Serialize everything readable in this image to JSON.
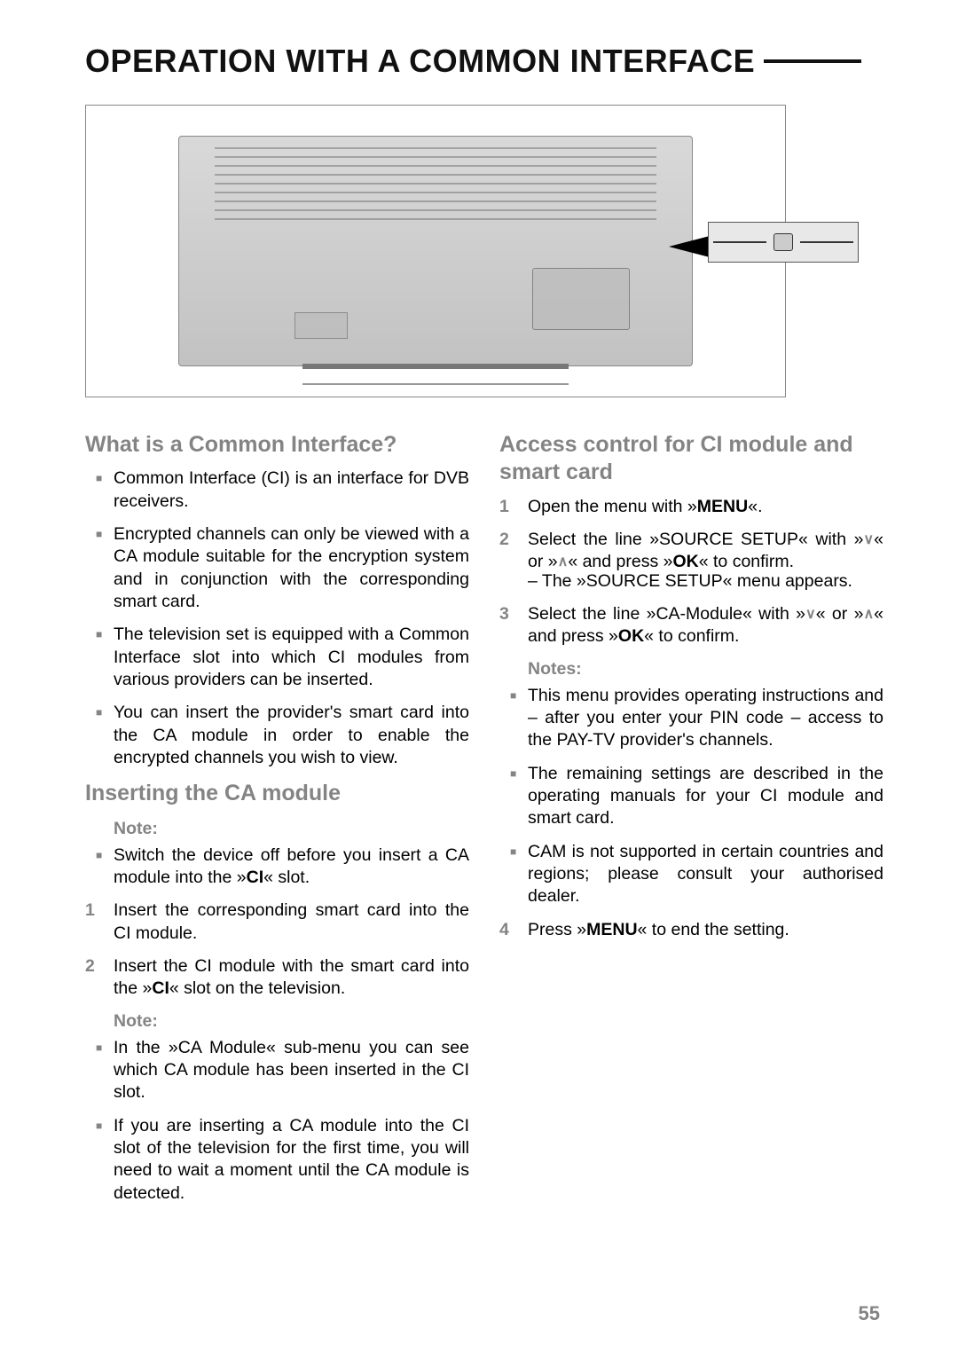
{
  "title": "OPERATION WITH A COMMON INTERFACE",
  "page_number": "55",
  "left": {
    "h_what": "What is a Common Interface?",
    "what_bullets": [
      "Common Interface (CI) is an interface for DVB receivers.",
      "Encrypted channels can only be viewed with a CA module suitable for the encryption system and in conjunction with the corresponding smart card.",
      "The television set is equipped with a Common Interface slot into which CI modules from various providers can be inserted.",
      "You can insert the provider's smart card into the CA module in order to enable the encrypted channels you wish to view."
    ],
    "h_insert": "Inserting the CA module",
    "note_label": "Note:",
    "note1": [
      "Switch the device off before you insert a CA module into the »CI« slot."
    ],
    "steps": [
      "Insert the corresponding smart card into the CI module.",
      "Insert the CI module with the smart card into the »CI« slot on the television."
    ],
    "note2": [
      "In the »CA Module« sub-menu you can see which CA module has been inserted in the CI slot.",
      "If you are inserting a CA module into the CI slot of the television for the first time, you will need to wait a moment until the CA module is detected."
    ]
  },
  "right": {
    "h_access": "Access control for CI module and smart card",
    "step1_pre": "Open the menu with »",
    "step1_bold": "MENU",
    "step1_post": "«.",
    "step2_pre": "Select the line »SOURCE SETUP« with »",
    "step2_mid": "« or »",
    "step2_mid2": "« and press »",
    "step2_bold": "OK",
    "step2_post": "« to confirm.",
    "step2_sub": "– The »SOURCE SETUP« menu appears.",
    "step3_pre": "Select the line »CA-Module« with »",
    "step3_mid": "« or »",
    "step3_mid2": "« and press »",
    "step3_bold": "OK",
    "step3_post": "« to confirm.",
    "notes_label": "Notes:",
    "notes": [
      "This menu provides operating instructions and – after you enter your PIN code – access to the PAY-TV provider's channels.",
      "The remaining settings are described in the operating manuals for your CI module and smart card.",
      "CAM is not supported in certain countries and regions; please consult your authorised dealer."
    ],
    "step4_pre": "Press »",
    "step4_bold": "MENU",
    "step4_post": "« to end the setting."
  }
}
